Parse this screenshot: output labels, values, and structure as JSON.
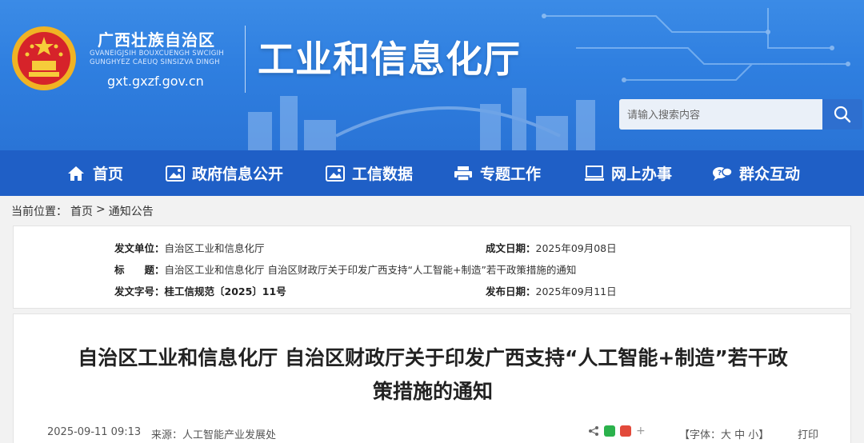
{
  "header": {
    "org_cn": "广西壮族自治区",
    "org_zh_line1": "GVANEIGJSIH BOUXCUENGH SWCIGIH",
    "org_zh_line2": "GUNGHYEZ CAEUQ SINSIZVA DINGH",
    "domain": "gxt.gxzf.gov.cn",
    "dept_title": "工业和信息化厅",
    "search_placeholder": "请输入搜索内容"
  },
  "nav": {
    "items": [
      {
        "label": "首页",
        "icon": "home-icon"
      },
      {
        "label": "政府信息公开",
        "icon": "image-icon"
      },
      {
        "label": "工信数据",
        "icon": "image-icon"
      },
      {
        "label": "专题工作",
        "icon": "printer-icon"
      },
      {
        "label": "网上办事",
        "icon": "monitor-icon"
      },
      {
        "label": "群众互动",
        "icon": "chat-icon"
      }
    ]
  },
  "breadcrumb": {
    "prefix": "当前位置：",
    "home": "首页",
    "sep": ">",
    "current": "通知公告"
  },
  "meta": {
    "issuer_k": "发文单位：",
    "issuer_v": "自治区工业和信息化厅",
    "date_k": "成文日期：",
    "date_v": "2025年09月08日",
    "title_k": "标　　题：",
    "title_v": "自治区工业和信息化厅 自治区财政厅关于印发广西支持“人工智能+制造”若干政策措施的通知",
    "docno_k": "发文字号：",
    "docno_v": "桂工信规范〔2025〕11号",
    "pub_k": "发布日期：",
    "pub_v": "2025年09月11日"
  },
  "article": {
    "title_line1": "自治区工业和信息化厅 自治区财政厅关于印发广西支持“人工智能+制造”若干政",
    "title_line2": "策措施的通知",
    "datetime": "2025-09-11 09:13",
    "source": "来源：人工智能产业发展处",
    "font_label": "【字体：大 中 小】",
    "print": "打印"
  },
  "colors": {
    "banner": "#2f7fe0",
    "nav": "#1f5fc6",
    "search_btn": "#2e6fcf"
  }
}
